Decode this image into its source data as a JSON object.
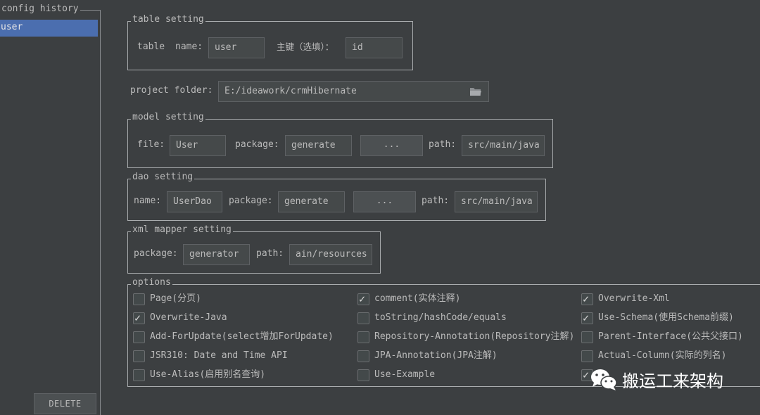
{
  "sidebar": {
    "legend": "config history",
    "items": [
      {
        "label": "user"
      }
    ],
    "delete_label": "DELETE"
  },
  "table_setting": {
    "legend": "table setting",
    "table_label": "table",
    "name_label": "name:",
    "name_value": "user",
    "pk_label": "主键（选填）：",
    "pk_value": "id"
  },
  "project": {
    "label": "project folder:",
    "value": "E:/ideawork/crmHibernate",
    "folder_icon": "folder-icon"
  },
  "model_setting": {
    "legend": "model setting",
    "file_label": "file:",
    "file_value": "User",
    "package_label": "package:",
    "package_value": "generate",
    "browse_label": "...",
    "path_label": "path:",
    "path_value": "src/main/java"
  },
  "dao_setting": {
    "legend": "dao setting",
    "name_label": "name:",
    "name_value": "UserDao",
    "package_label": "package:",
    "package_value": "generate",
    "browse_label": "...",
    "path_label": "path:",
    "path_value": "src/main/java"
  },
  "xml_setting": {
    "legend": "xml mapper setting",
    "package_label": "package:",
    "package_value": "generator",
    "path_label": "path:",
    "path_value": "ain/resources"
  },
  "options": {
    "legend": "options",
    "items": [
      {
        "label": "Page(分页)",
        "checked": false
      },
      {
        "label": "comment(实体注释)",
        "checked": true
      },
      {
        "label": "Overwrite-Xml",
        "checked": true
      },
      {
        "label": "Overwrite-Java",
        "checked": true
      },
      {
        "label": "toString/hashCode/equals",
        "checked": false
      },
      {
        "label": "Use-Schema(使用Schema前缀)",
        "checked": true
      },
      {
        "label": "Add-ForUpdate(select增加ForUpdate)",
        "checked": false
      },
      {
        "label": "Repository-Annotation(Repository注解)",
        "checked": false
      },
      {
        "label": "Parent-Interface(公共父接口)",
        "checked": false
      },
      {
        "label": "JSR310: Date and Time API",
        "checked": false
      },
      {
        "label": "JPA-Annotation(JPA注解)",
        "checked": false
      },
      {
        "label": "Actual-Column(实际的列名)",
        "checked": false
      },
      {
        "label": "Use-Alias(启用别名查询)",
        "checked": false
      },
      {
        "label": "Use-Example",
        "checked": false
      },
      {
        "label": "",
        "checked": true
      }
    ]
  },
  "watermark": {
    "text": "搬运工来架构",
    "icon": "wechat-icon",
    "color": "#ffffff"
  },
  "colors": {
    "background": "#3c3f41",
    "selection": "#4b6eaf",
    "field": "#45494a",
    "text": "#bbbbbb"
  }
}
